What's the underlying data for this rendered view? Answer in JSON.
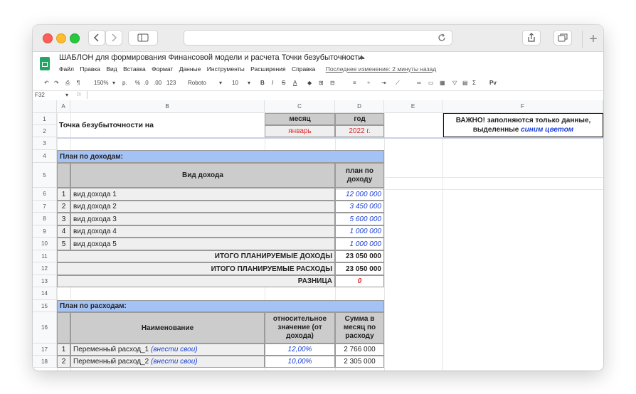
{
  "browser": {
    "back_icon": "chevron-left-icon",
    "forward_icon": "chevron-right-icon",
    "sidebar_icon": "sidebar-icon",
    "reload_icon": "reload-icon",
    "share_icon": "share-icon",
    "tabs_icon": "tabs-icon",
    "new_tab": "+"
  },
  "doc": {
    "title": "ШАБЛОН для формирования Финансовой модели и расчета Точки безубыточности",
    "menu": [
      "Файл",
      "Правка",
      "Вид",
      "Вставка",
      "Формат",
      "Данные",
      "Инструменты",
      "Расширения",
      "Справка"
    ],
    "last_edit": "Последнее изменение: 2 минуты назад"
  },
  "toolbar": {
    "zoom": "150%",
    "currency": "р.",
    "percent": "%",
    "dec_less": ".0",
    "dec_more": ".00",
    "format": "123",
    "font": "Roboto",
    "size": "10",
    "bold": "B",
    "italic": "I",
    "strike": "S",
    "underline_a": "A",
    "sigma": "Σ",
    "pv": "Pv"
  },
  "formula_bar": {
    "cell_ref": "F32",
    "fx": "fx"
  },
  "columns": [
    "A",
    "B",
    "C",
    "D",
    "E",
    "F"
  ],
  "rows": [
    "1",
    "2",
    "3",
    "4",
    "5",
    "6",
    "7",
    "8",
    "9",
    "10",
    "11",
    "12",
    "13",
    "14",
    "15",
    "16",
    "17",
    "18"
  ],
  "sheet": {
    "break_even_label": "Точка безубыточности на",
    "month_header": "месяц",
    "year_header": "год",
    "month_value": "январь",
    "year_value": "2022 г.",
    "important_1": "ВАЖНО! заполняются только данные,",
    "important_2": "выделенные",
    "important_blue": "синим цветом",
    "income_plan_title": "План по доходам:",
    "income_type_header": "Вид дохода",
    "income_plan_header": "план по доходу",
    "income_rows": [
      {
        "n": "1",
        "name": "вид дохода 1",
        "value": "12 000 000"
      },
      {
        "n": "2",
        "name": "вид дохода 2",
        "value": "3 450 000"
      },
      {
        "n": "3",
        "name": "вид дохода 3",
        "value": "5 600 000"
      },
      {
        "n": "4",
        "name": "вид дохода 4",
        "value": "1 000 000"
      },
      {
        "n": "5",
        "name": "вид дохода 5",
        "value": "1 000 000"
      }
    ],
    "total_income_label": "ИТОГО ПЛАНИРУЕМЫЕ ДОХОДЫ",
    "total_income_value": "23 050 000",
    "total_expense_label": "ИТОГО ПЛАНИРУЕМЫЕ РАСХОДЫ",
    "total_expense_value": "23 050 000",
    "difference_label": "РАЗНИЦА",
    "difference_value": "0",
    "expense_plan_title": "План по расходам:",
    "expense_name_header": "Наименование",
    "expense_rel_header": "относительное значение (от дохода)",
    "expense_sum_header": "Сумма в месяц по расходу",
    "expense_rows": [
      {
        "n": "1",
        "name": "Переменный расход_1",
        "note": "(внести свои)",
        "rel": "12,00%",
        "sum": "2 766 000"
      },
      {
        "n": "2",
        "name": "Переменный расход_2",
        "note": "(внести свои)",
        "rel": "10,00%",
        "sum": "2 305 000"
      }
    ]
  }
}
